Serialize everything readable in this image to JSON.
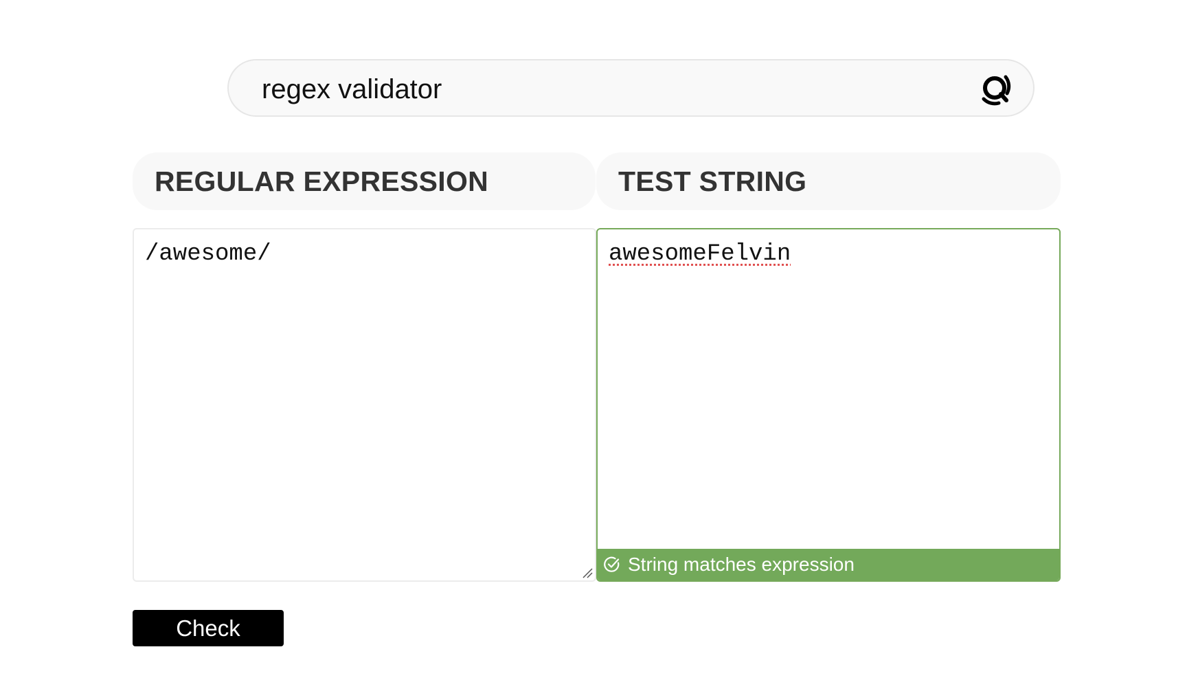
{
  "search": {
    "query": "regex validator",
    "icon": "search-icon"
  },
  "sections": {
    "regex_header": "REGULAR EXPRESSION",
    "test_header": "TEST STRING"
  },
  "regex_panel": {
    "value": "/awesome/"
  },
  "test_panel": {
    "value": "awesomeFelvin",
    "status": "String matches expression",
    "status_icon": "check-circle-icon",
    "status_color": "#73a95a",
    "border_color": "#76a95a"
  },
  "actions": {
    "check_label": "Check"
  }
}
